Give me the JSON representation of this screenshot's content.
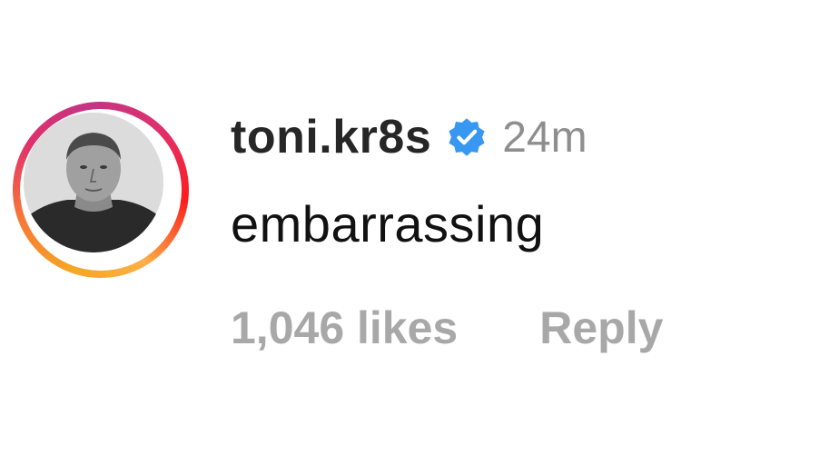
{
  "comment": {
    "username": "toni.kr8s",
    "verified_icon": "verified-badge-icon",
    "time_ago": "24m",
    "text": "embarrassing",
    "likes": "1,046 likes",
    "reply_label": "Reply"
  },
  "colors": {
    "verified": "#3897f0",
    "muted_text": "#a8a8a8",
    "primary_text": "#262626"
  }
}
